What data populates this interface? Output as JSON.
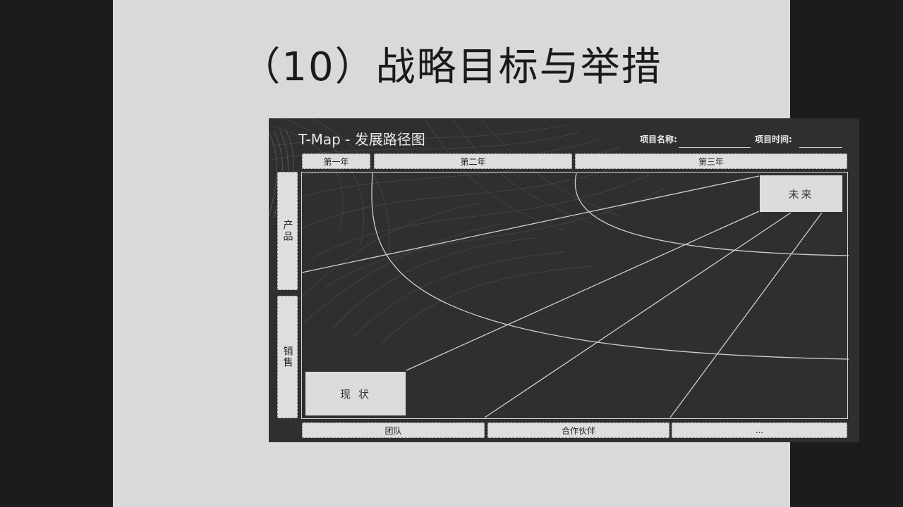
{
  "slide": {
    "title": "（10）战略目标与举措"
  },
  "tmap": {
    "title": "T-Map - 发展路径图",
    "project_name_label": "项目名称:",
    "project_time_label": "项目时间:",
    "year_headers": [
      "第一年",
      "第二年",
      "第三年"
    ],
    "row_labels": [
      "产品",
      "销售"
    ],
    "footer_cells": [
      "团队",
      "合作伙伴",
      "..."
    ],
    "future_label": "未来",
    "current_label": "现  状"
  },
  "colors": {
    "page_bg": "#1c1c1c",
    "slide_bg": "#d9d9d9",
    "panel_bg": "#2f2f2f",
    "cell_bg": "#dedede",
    "line": "#d0d0d0"
  }
}
